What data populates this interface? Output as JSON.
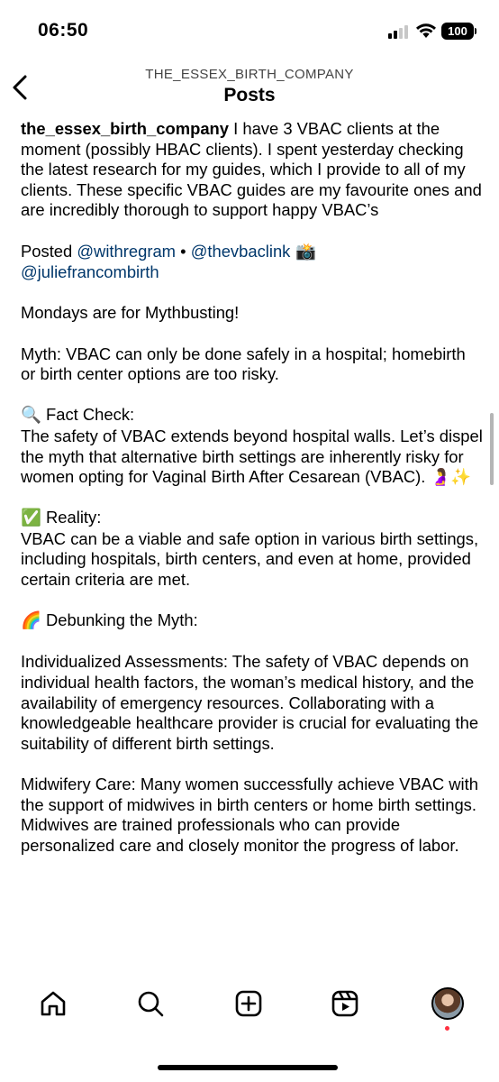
{
  "status_bar": {
    "time": "06:50",
    "battery": "100",
    "signal_bars_filled": 2,
    "signal_bars_total": 4
  },
  "header": {
    "account": "THE_ESSEX_BIRTH_COMPANY",
    "title": "Posts"
  },
  "caption": {
    "username": "the_essex_birth_company",
    "intro": " I have 3 VBAC clients at the moment (possibly HBAC clients). I spent yesterday checking the latest research for my guides, which I provide to all of my clients. These specific VBAC guides are my favourite ones and are incredibly thorough to support happy VBAC’s",
    "posted_prefix": "Posted ",
    "mention_1": "@withregram",
    "separator": " • ",
    "mention_2": "@thevbaclink",
    "camera_emoji": " 📸",
    "mention_3": "@juliefrancombirth",
    "mondays": "Mondays are for Mythbusting!",
    "myth": "Myth: VBAC can only be done safely in a hospital; homebirth or birth center options are too risky.",
    "fact_check_emoji": "🔍",
    "fact_check_heading": " Fact Check:",
    "fact_check_body": "The safety of VBAC extends beyond hospital walls. Let’s dispel the myth that alternative birth settings are inherently risky for women opting for Vaginal Birth After Cesarean (VBAC). 🤰✨",
    "reality_emoji": "✅",
    "reality_heading": " Reality:",
    "reality_body": "VBAC can be a viable and safe option in various birth settings, including hospitals, birth centers, and even at home, provided certain criteria are met.",
    "debunk_emoji": "🌈",
    "debunk_heading": " Debunking the Myth:",
    "individualized": "Individualized Assessments: The safety of VBAC depends on individual health factors, the woman’s medical history, and the availability of emergency resources. Collaborating with a knowledgeable healthcare provider is crucial for evaluating the suitability of different birth settings.",
    "midwifery": "Midwifery Care: Many women successfully achieve VBAC with the support of midwives in birth centers or home birth settings. Midwives are trained professionals who can provide personalized care and closely monitor the progress of labor."
  },
  "nav": {
    "items": [
      "home-icon",
      "search-icon",
      "create-icon",
      "reels-icon",
      "profile-avatar"
    ],
    "notification_color": "#ff3040"
  },
  "colors": {
    "mention": "#00376b",
    "background": "#ffffff",
    "text": "#000000"
  }
}
